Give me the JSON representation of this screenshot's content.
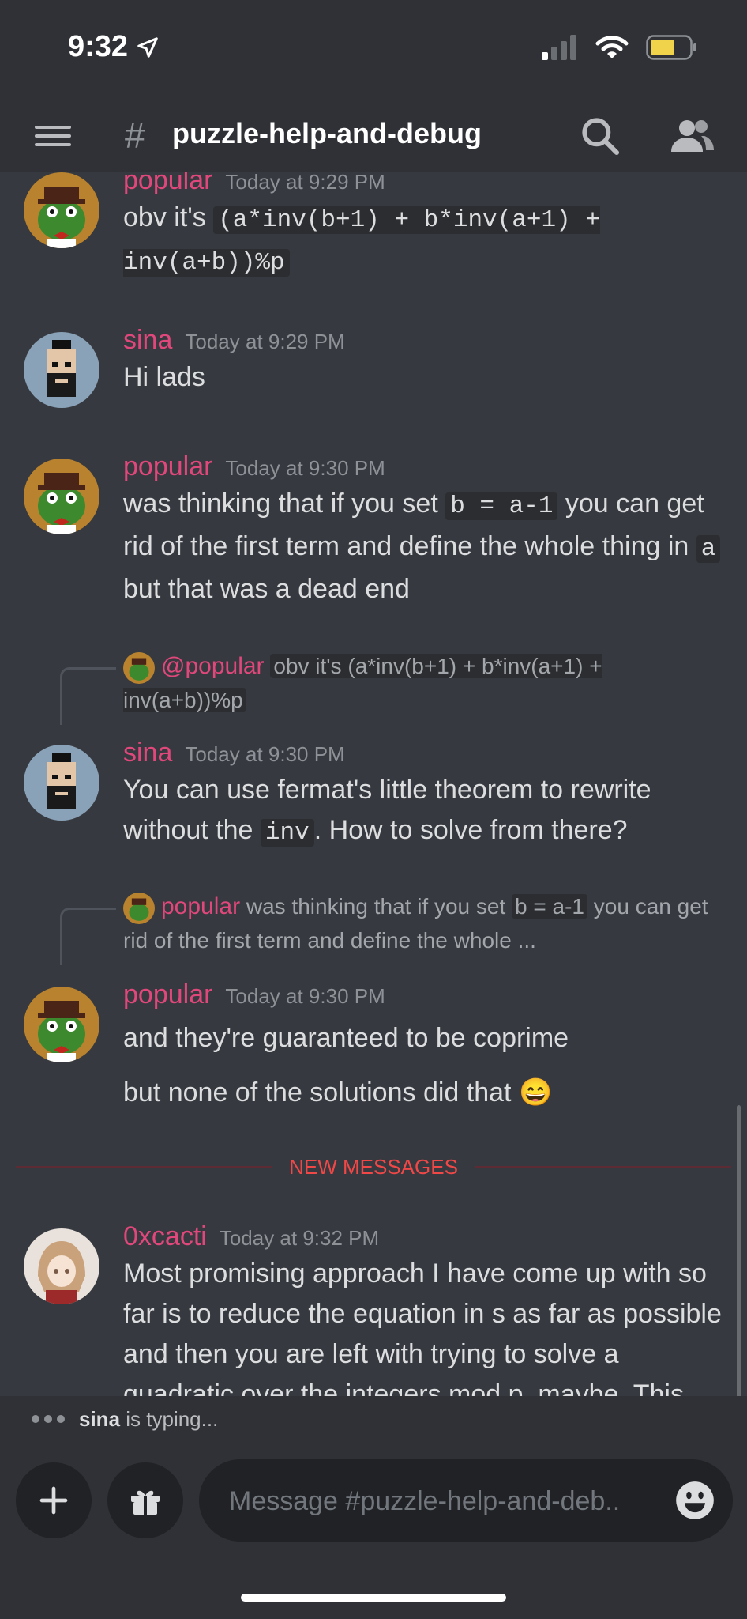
{
  "status": {
    "time": "9:32",
    "battery_color": "#f0d34a"
  },
  "header": {
    "channel": "puzzle-help-and-debug",
    "hash": "#"
  },
  "messages": {
    "m1": {
      "user": "popular",
      "time": "Today at 9:29 PM",
      "text_pre": "obv it's ",
      "code": "(a*inv(b+1) + b*inv(a+1) + inv(a+b))%p"
    },
    "m2": {
      "user": "sina",
      "time": "Today at 9:29 PM",
      "text": "Hi lads"
    },
    "m3": {
      "user": "popular",
      "time": "Today at 9:30 PM",
      "t1": "was thinking that if you set ",
      "c1": "b = a-1",
      "t2": " you can get rid of the first term and define the whole thing in ",
      "c2": "a",
      "t3": " but that was a dead end"
    },
    "r4": {
      "user": "@popular",
      "text": "obv it's (a*inv(b+1) + b*inv(a+1) + inv(a+b))%p"
    },
    "m4": {
      "user": "sina",
      "time": "Today at 9:30 PM",
      "t1": "You can use fermat's little theorem to rewrite without the ",
      "c1": "inv",
      "t2": ". How to solve from there?"
    },
    "r5": {
      "user": "popular",
      "t1": "was thinking that if you set ",
      "c1": "b = a-1",
      "t2": " you can get rid of the first term and define the whole ..."
    },
    "m5": {
      "user": "popular",
      "time": "Today at 9:30 PM",
      "line1": "and they're guaranteed to be coprime",
      "line2": "but none of the solutions did that",
      "emoji": "😄"
    },
    "divider": "NEW MESSAGES",
    "m6": {
      "user": "0xcacti",
      "time": "Today at 9:32 PM",
      "text": "Most promising approach I have come up with so far is to reduce the equation in s as far as possible and then you are left with trying to solve a quadratic over the integers mod p, maybe. This"
    }
  },
  "typing": {
    "user": "sina",
    "suffix": " is typing..."
  },
  "composer": {
    "placeholder": "Message #puzzle-help-and-deb.."
  },
  "colors": {
    "username": "#e0477a",
    "divider": "#f04747",
    "background": "#36393f"
  }
}
